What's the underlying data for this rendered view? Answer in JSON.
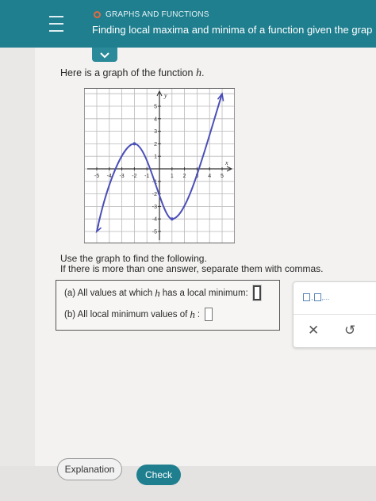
{
  "header": {
    "menu_icon": "hamburger-icon",
    "topic": "GRAPHS AND FUNCTIONS",
    "title": "Finding local maxima and minima of a function given the grap",
    "collapse_icon": "chevron-down-icon"
  },
  "intro": {
    "text": "Here is a graph of the function ",
    "fn": "h",
    "end": "."
  },
  "graph": {
    "y_axis_label": "y",
    "x_axis_label": "x",
    "x_ticks": [
      "-5",
      "-4",
      "-3",
      "-2",
      "-1",
      "1",
      "2",
      "3",
      "4",
      "5"
    ],
    "y_ticks": [
      "5",
      "4",
      "3",
      "2",
      "1",
      "-1",
      "-2",
      "-3",
      "-4",
      "-5"
    ],
    "curve_points": [
      [
        -5,
        -5
      ],
      [
        -2,
        2
      ],
      [
        1,
        -4
      ],
      [
        5,
        6
      ]
    ],
    "local_max": [
      -2,
      2
    ],
    "local_min": [
      1,
      -4
    ],
    "curve_color": "#4b4fb8"
  },
  "instructions": {
    "line1": "Use the graph to find the following.",
    "line2": "If there is more than one answer, separate them with commas."
  },
  "questions": {
    "a_text": "(a) All values at which ",
    "a_fn": "h",
    "a_end": " has a local minimum:",
    "b_text": "(b) All local minimum values of ",
    "b_fn": "h",
    "b_end": ":"
  },
  "tools": {
    "interval_label": "□,□,...",
    "clear_icon": "x-icon",
    "undo_icon": "undo-icon"
  },
  "footer": {
    "explanation": "Explanation",
    "check": "Check"
  }
}
